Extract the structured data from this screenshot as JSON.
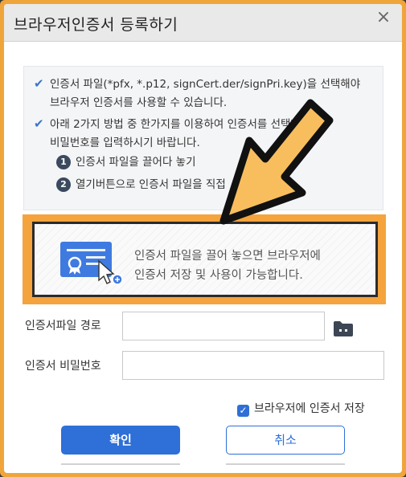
{
  "dialog": {
    "title": "브라우저인증서 등록하기",
    "close_glyph": "×"
  },
  "info": {
    "check_glyph": "✔",
    "line1a": "인증서 파일(*pfx, *.p12, signCert.der/signPri.key)을 선택해야",
    "line1b": "브라우저 인증서를 사용할 수 있습니다.",
    "line2a": "아래 2가지 방법 중 한가지를 이용하여 인증서를 선택한 후",
    "line2b": "비밀번호를 입력하시기 바랍니다.",
    "step1_num": "1",
    "step1": "인증서 파일을 끌어다 놓기",
    "step2_num": "2",
    "step2": "열기버튼으로 인증서 파일을 직접"
  },
  "dropzone": {
    "line1": "인증서 파일을 끌어 놓으면 브라우저에",
    "line2": "인증서 저장 및 사용이 가능합니다."
  },
  "form": {
    "path_label": "인증서파일 경로",
    "path_value": "",
    "password_label": "인증서 비밀번호",
    "password_value": ""
  },
  "save_checkbox": {
    "label": "브라우저에 인증서 저장",
    "checked": true,
    "check_glyph": "✓"
  },
  "buttons": {
    "ok": "확인",
    "cancel": "취소"
  },
  "colors": {
    "highlight": "#f5a33d",
    "primary": "#2e6fd8",
    "arrow_fill": "#f8be5e"
  }
}
